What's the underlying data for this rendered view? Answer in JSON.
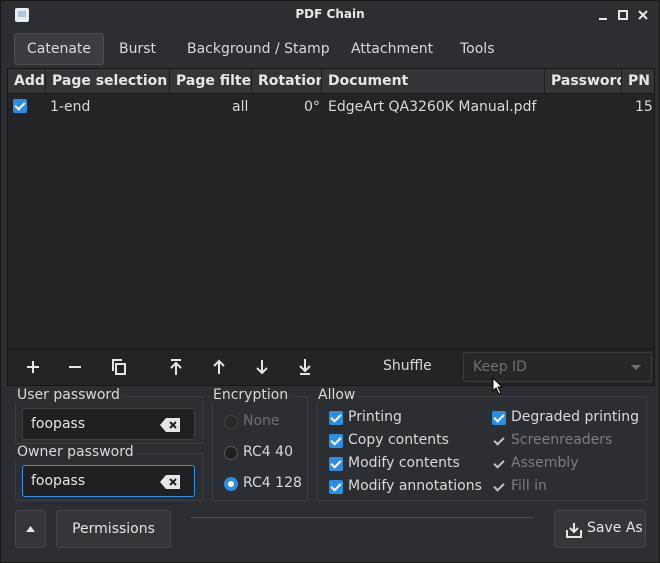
{
  "window": {
    "title": "PDF Chain"
  },
  "tabs": [
    {
      "label": "Catenate",
      "active": true
    },
    {
      "label": "Burst"
    },
    {
      "label": "Background / Stamp"
    },
    {
      "label": "Attachment"
    },
    {
      "label": "Tools"
    }
  ],
  "table": {
    "headers": [
      "Add",
      "Page selection",
      "Page filter",
      "Rotation",
      "Document",
      "Password",
      "PN"
    ],
    "rows": [
      {
        "add": true,
        "page_selection": "1-end",
        "page_filter": "all",
        "rotation": "0°",
        "document": "EdgeArt QA3260K Manual.pdf",
        "password": "",
        "pn": "15"
      }
    ]
  },
  "toolbar": {
    "icons": [
      "add-icon",
      "remove-icon",
      "copy-icon",
      "move-top-icon",
      "move-up-icon",
      "move-down-icon",
      "move-bottom-icon"
    ],
    "shuffle_label": "Shuffle",
    "keep_id_placeholder": "Keep ID"
  },
  "passwords": {
    "user_label": "User password",
    "user_value": "foopass",
    "owner_label": "Owner password",
    "owner_value": "foopass"
  },
  "encryption": {
    "label": "Encryption",
    "options": [
      {
        "label": "None",
        "enabled": false,
        "selected": false
      },
      {
        "label": "RC4 40",
        "enabled": true,
        "selected": false
      },
      {
        "label": "RC4 128",
        "enabled": true,
        "selected": true
      }
    ]
  },
  "allow": {
    "label": "Allow",
    "items": [
      {
        "label": "Printing",
        "checked": true,
        "enabled": true
      },
      {
        "label": "Copy contents",
        "checked": true,
        "enabled": true
      },
      {
        "label": "Modify contents",
        "checked": true,
        "enabled": true
      },
      {
        "label": "Modify annotations",
        "checked": true,
        "enabled": true
      },
      {
        "label": "Degraded printing",
        "checked": true,
        "enabled": true
      },
      {
        "label": "Screenreaders",
        "checked": true,
        "enabled": false
      },
      {
        "label": "Assembly",
        "checked": true,
        "enabled": false
      },
      {
        "label": "Fill in",
        "checked": true,
        "enabled": false
      }
    ]
  },
  "footer": {
    "permissions_label": "Permissions",
    "save_label": "Save As"
  },
  "colors": {
    "accent": "#2f8de0",
    "background": "#2b2e33",
    "table_bg": "#222428"
  }
}
